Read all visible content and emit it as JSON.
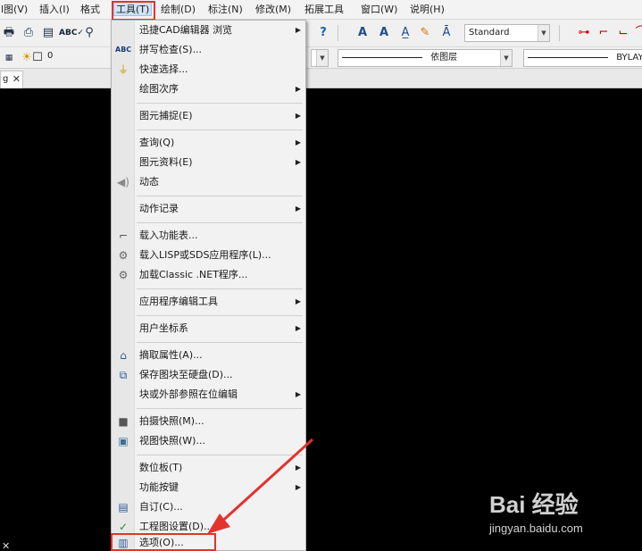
{
  "menubar": {
    "items": [
      {
        "label": "l图(V)"
      },
      {
        "label": "插入(I)"
      },
      {
        "label": "格式"
      },
      {
        "label": "工具(T)"
      },
      {
        "label": "绘制(D)"
      },
      {
        "label": "标注(N)"
      },
      {
        "label": "修改(M)"
      },
      {
        "label": "拓展工具"
      },
      {
        "label": "窗口(W)"
      },
      {
        "label": "说明(H)"
      }
    ]
  },
  "toolbar": {
    "text_style": "Standard",
    "layer_name": "0",
    "linetype": "依图层",
    "lineweight": "BYLAYE"
  },
  "document_tab": {
    "label": "g",
    "close": "✕"
  },
  "tools_menu": {
    "items": [
      {
        "label": "迅捷CAD编辑器 浏览",
        "icon": "",
        "submenu": true
      },
      {
        "label": "拼写检查(S)...",
        "icon": "spell-check-icon",
        "submenu": false
      },
      {
        "label": "快速选择...",
        "icon": "quick-select-icon",
        "submenu": false
      },
      {
        "label": "绘图次序",
        "icon": "",
        "submenu": true
      },
      {
        "label": "图元捕捉(E)",
        "icon": "",
        "submenu": true
      },
      {
        "label": "查询(Q)",
        "icon": "",
        "submenu": true
      },
      {
        "label": "图元资料(E)",
        "icon": "",
        "submenu": true
      },
      {
        "label": "动态",
        "icon": "speaker-icon",
        "submenu": false
      },
      {
        "label": "动作记录",
        "icon": "",
        "submenu": true
      },
      {
        "label": "载入功能表...",
        "icon": "load-menu-icon",
        "submenu": false
      },
      {
        "label": "载入LISP或SDS应用程序(L)...",
        "icon": "gear-icon",
        "submenu": false
      },
      {
        "label": "加载Classic .NET程序...",
        "icon": "gear-icon",
        "submenu": false
      },
      {
        "label": "应用程序编辑工具",
        "icon": "",
        "submenu": true
      },
      {
        "label": "用户坐标系",
        "icon": "",
        "submenu": true
      },
      {
        "label": "摘取属性(A)...",
        "icon": "extract-attributes-icon",
        "submenu": false
      },
      {
        "label": "保存图块至硬盘(D)...",
        "icon": "save-block-icon",
        "submenu": false
      },
      {
        "label": "块或外部参照在位编辑",
        "icon": "",
        "submenu": true
      },
      {
        "label": "拍摄快照(M)...",
        "icon": "camera-icon",
        "submenu": false
      },
      {
        "label": "视图快照(W)...",
        "icon": "view-snapshot-icon",
        "submenu": false
      },
      {
        "label": "数位板(T)",
        "icon": "",
        "submenu": true
      },
      {
        "label": "功能按键",
        "icon": "",
        "submenu": true
      },
      {
        "label": "自订(C)...",
        "icon": "customize-icon",
        "submenu": false
      },
      {
        "label": "工程图设置(D)...",
        "icon": "drawing-settings-icon",
        "submenu": false
      },
      {
        "label": "选项(O)...",
        "icon": "options-icon",
        "submenu": false
      }
    ]
  },
  "watermark": {
    "brand": "Bai 经验",
    "url": "jingyan.baidu.com"
  },
  "colors": {
    "highlight": "#e2332e",
    "canvas": "#000000",
    "menu_bg": "#f2f2f2"
  }
}
